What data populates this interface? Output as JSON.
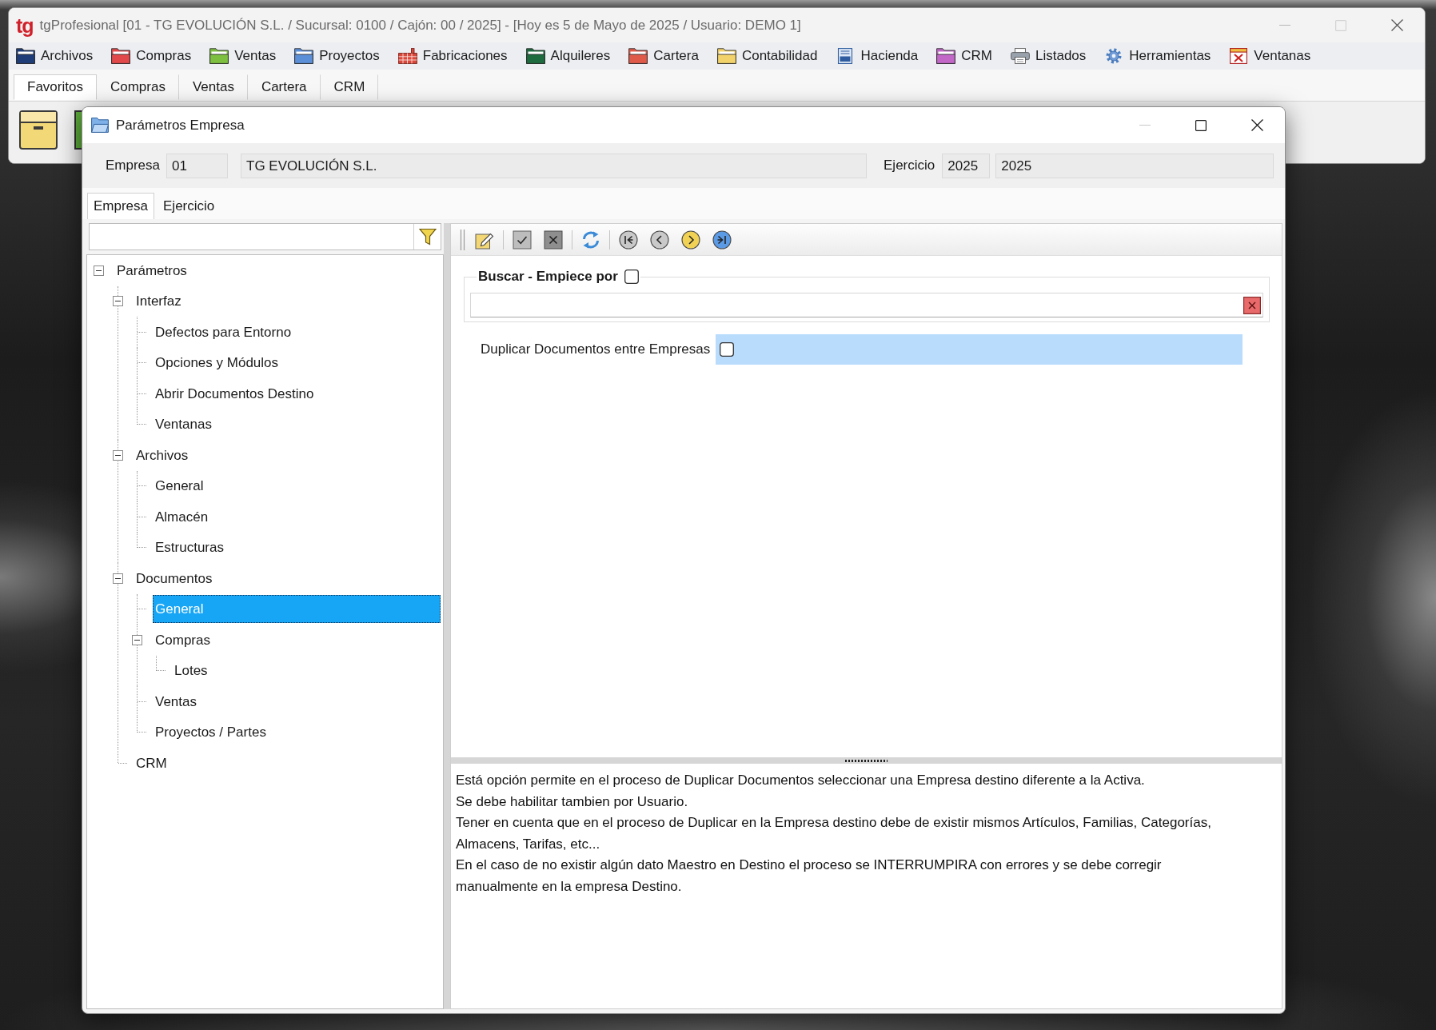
{
  "app_window": {
    "logo": "tg",
    "title": "tgProfesional [01 - TG EVOLUCIÓN S.L. / Sucursal: 0100 / Cajón: 00 / 2025] - [Hoy es 5 de Mayo de 2025 / Usuario: DEMO 1]",
    "menu": [
      {
        "label": "Archivos",
        "kind": "folder",
        "color": "#1e3c78"
      },
      {
        "label": "Compras",
        "kind": "folder",
        "color": "#e2494b"
      },
      {
        "label": "Ventas",
        "kind": "folder",
        "color": "#7dbf3f"
      },
      {
        "label": "Proyectos",
        "kind": "folder",
        "color": "#5b8fd8"
      },
      {
        "label": "Fabricaciones",
        "kind": "factory"
      },
      {
        "label": "Alquileres",
        "kind": "folder",
        "color": "#1d6b3e"
      },
      {
        "label": "Cartera",
        "kind": "folder",
        "color": "#e05a4a"
      },
      {
        "label": "Contabilidad",
        "kind": "folder",
        "color": "#f2d36b"
      },
      {
        "label": "Hacienda",
        "kind": "document"
      },
      {
        "label": "CRM",
        "kind": "folder",
        "color": "#c266c8"
      },
      {
        "label": "Listados",
        "kind": "printer"
      },
      {
        "label": "Herramientas",
        "kind": "gear"
      },
      {
        "label": "Ventanas",
        "kind": "windows"
      }
    ],
    "tabs": [
      {
        "label": "Favoritos",
        "selected": true
      },
      {
        "label": "Compras",
        "selected": false
      },
      {
        "label": "Ventas",
        "selected": false
      },
      {
        "label": "Cartera",
        "selected": false
      },
      {
        "label": "CRM",
        "selected": false
      }
    ]
  },
  "dialog": {
    "title": "Parámetros Empresa",
    "header": {
      "company": {
        "label": "Empresa",
        "code": "01",
        "name": "TG EVOLUCIÓN S.L."
      },
      "fiscal_year": {
        "label": "Ejercicio",
        "code": "2025",
        "name": "2025"
      }
    },
    "tabs": [
      {
        "label": "Empresa",
        "selected": true
      },
      {
        "label": "Ejercicio",
        "selected": false
      }
    ],
    "tree": {
      "items": [
        {
          "label": "Parámetros",
          "expanded": true,
          "selected": false,
          "children": [
            {
              "label": "Interfaz",
              "expanded": true,
              "selected": false,
              "children": [
                {
                  "label": "Defectos para Entorno",
                  "selected": false
                },
                {
                  "label": "Opciones y Módulos",
                  "selected": false
                },
                {
                  "label": "Abrir Documentos Destino",
                  "selected": false
                },
                {
                  "label": "Ventanas",
                  "selected": false
                }
              ]
            },
            {
              "label": "Archivos",
              "expanded": true,
              "selected": false,
              "children": [
                {
                  "label": "General",
                  "selected": false
                },
                {
                  "label": "Almacén",
                  "selected": false
                },
                {
                  "label": "Estructuras",
                  "selected": false
                }
              ]
            },
            {
              "label": "Documentos",
              "expanded": true,
              "selected": false,
              "children": [
                {
                  "label": "General",
                  "selected": true
                },
                {
                  "label": "Compras",
                  "expanded": true,
                  "selected": false,
                  "children": [
                    {
                      "label": "Lotes",
                      "selected": false
                    }
                  ]
                },
                {
                  "label": "Ventas",
                  "selected": false
                },
                {
                  "label": "Proyectos / Partes",
                  "selected": false
                }
              ]
            },
            {
              "label": "CRM",
              "selected": false
            }
          ]
        }
      ]
    },
    "toolbar": [
      {
        "kind": "edit",
        "disabled": false
      },
      {
        "kind": "accept",
        "disabled": true
      },
      {
        "kind": "cancel",
        "disabled": true
      },
      {
        "kind": "refresh",
        "disabled": false
      },
      {
        "kind": "first",
        "disabled": true
      },
      {
        "kind": "previous",
        "disabled": true
      },
      {
        "kind": "next",
        "disabled": false
      },
      {
        "kind": "last",
        "disabled": false
      }
    ],
    "search": {
      "label": "Buscar - Empiece por",
      "checked": false
    },
    "fields": [
      {
        "label": "Duplicar Documentos entre Empresas",
        "checked": false,
        "selected": true
      }
    ],
    "description": {
      "paragraphs": [
        "Está opción permite en el proceso de Duplicar Documentos seleccionar una Empresa destino diferente a la Activa.",
        "Se debe habilitar tambien por Usuario.",
        "Tener en cuenta que en el proceso de Duplicar en la Empresa destino debe de existir mismos Artículos, Familias, Categorías, Almacens, Tarifas, etc...",
        "En el caso de no existir algún dato Maestro en Destino el proceso se INTERRUMPIRA con errores y se debe corregir manualmente en la empresa Destino."
      ]
    }
  }
}
